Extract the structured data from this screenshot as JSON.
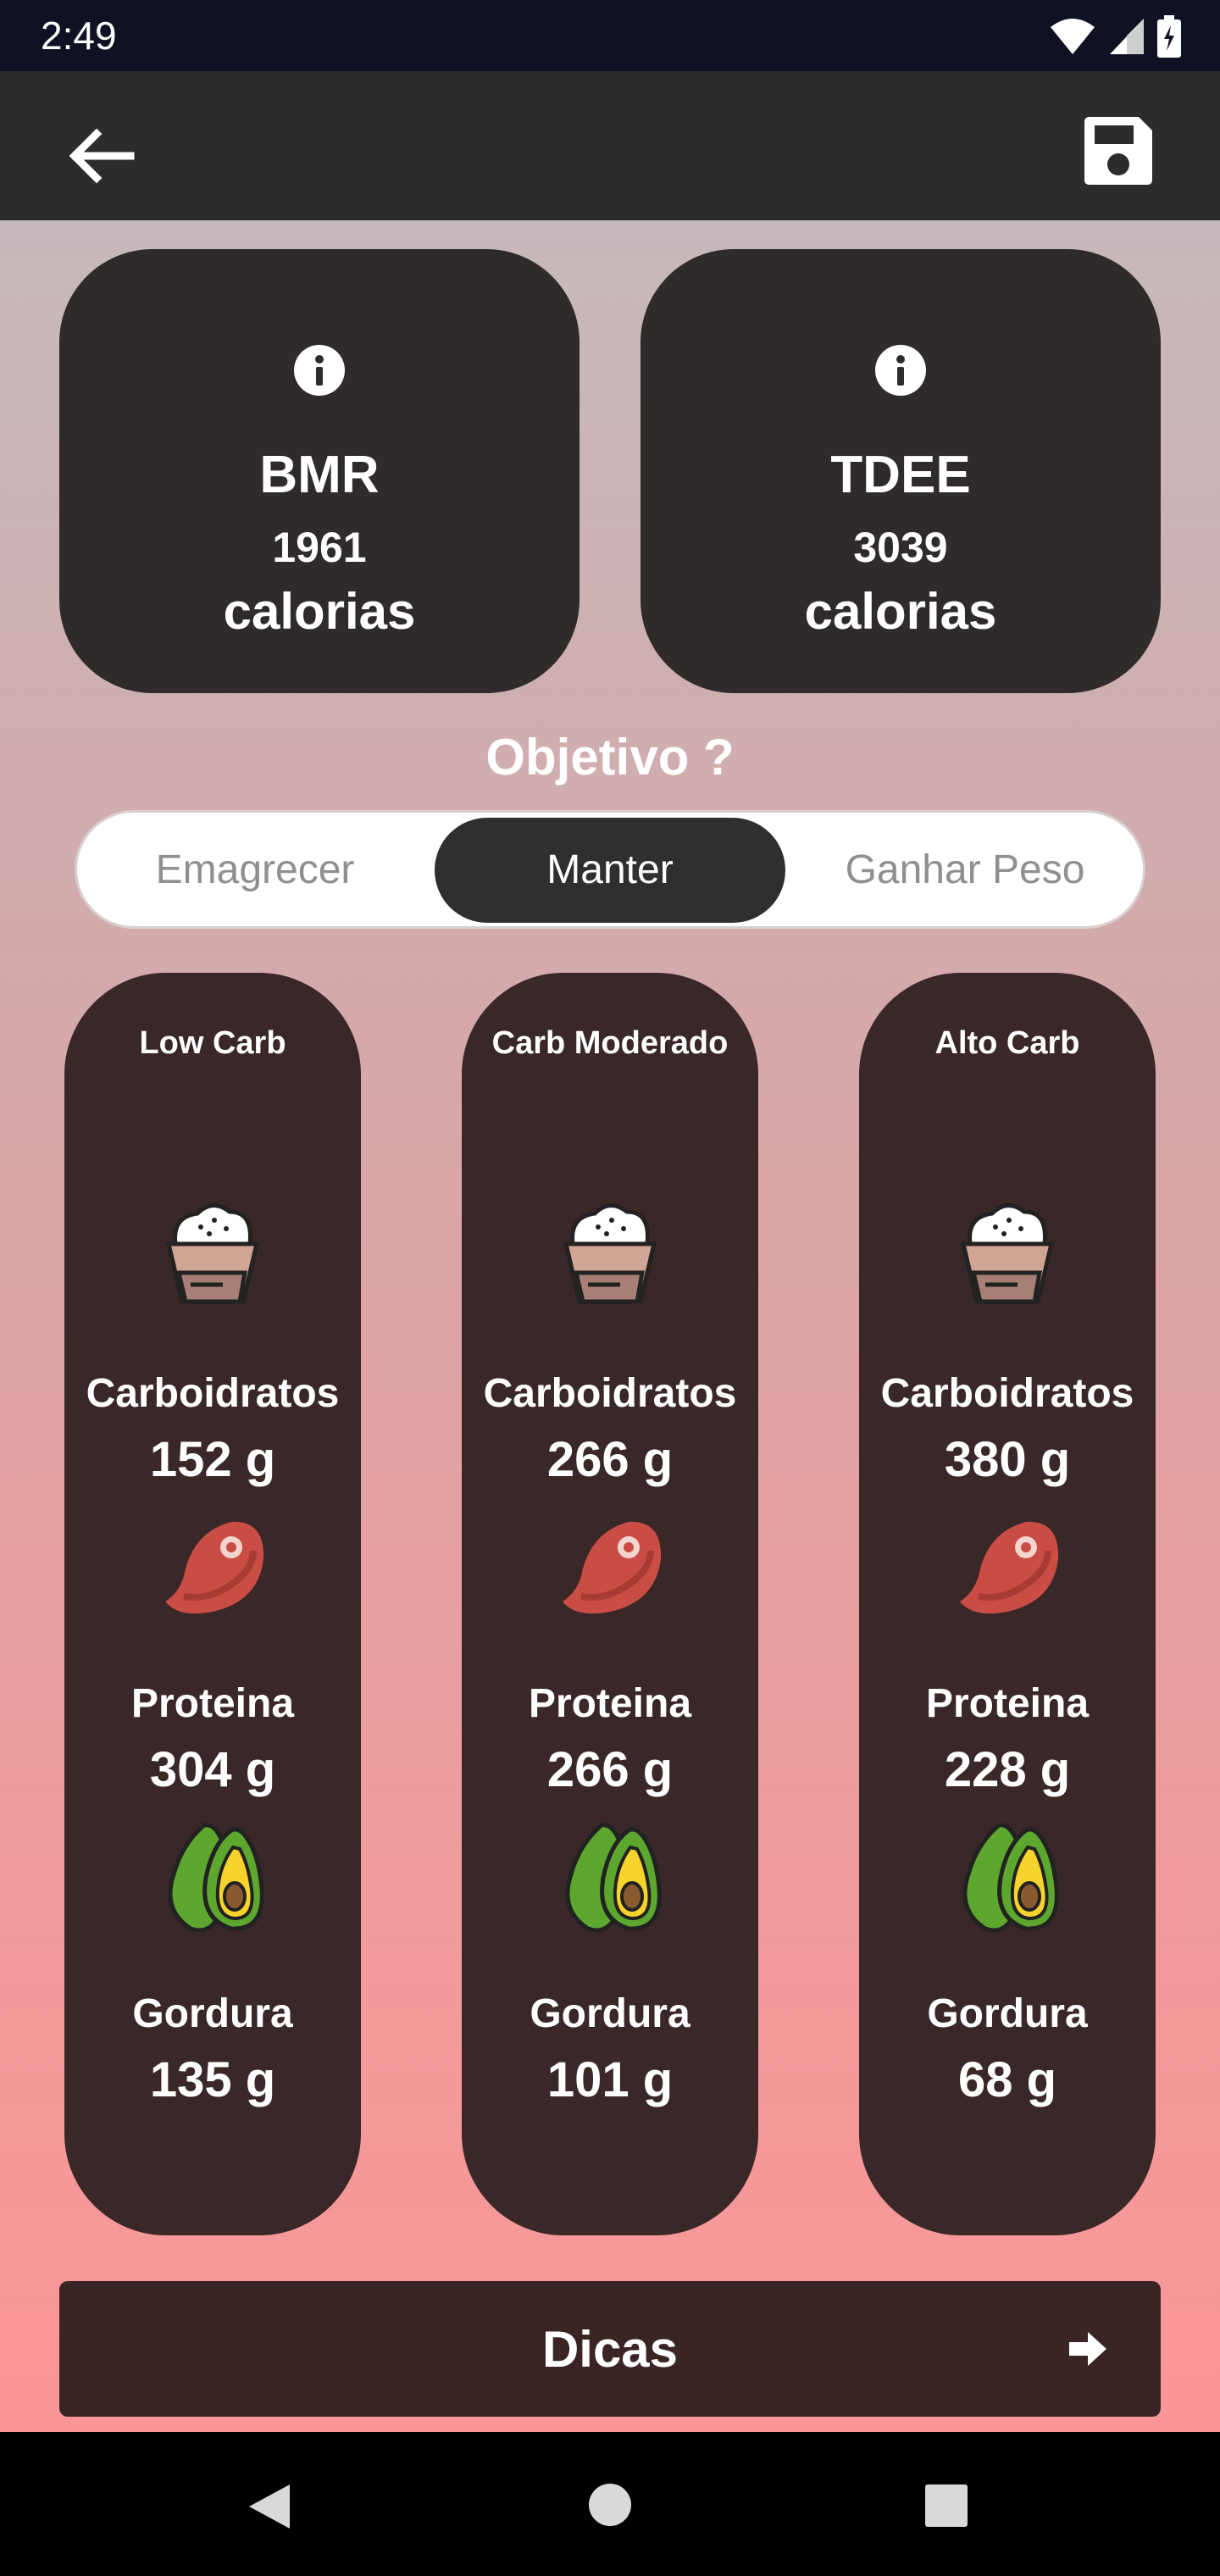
{
  "status": {
    "time": "2:49"
  },
  "summary": {
    "bmr": {
      "name": "BMR",
      "value": "1961",
      "unit": "calorias"
    },
    "tdee": {
      "name": "TDEE",
      "value": "3039",
      "unit": "calorias"
    }
  },
  "objective": {
    "title": "Objetivo ?",
    "options": [
      "Emagrecer",
      "Manter",
      "Ganhar Peso"
    ],
    "selected": "Manter"
  },
  "diets": [
    {
      "title": "Low Carb",
      "carb_label": "Carboidratos",
      "carb": "152 g",
      "protein_label": "Proteina",
      "protein": "304 g",
      "fat_label": "Gordura",
      "fat": "135 g"
    },
    {
      "title": "Carb Moderado",
      "carb_label": "Carboidratos",
      "carb": "266 g",
      "protein_label": "Proteina",
      "protein": "266 g",
      "fat_label": "Gordura",
      "fat": "101 g"
    },
    {
      "title": "Alto Carb",
      "carb_label": "Carboidratos",
      "carb": "380 g",
      "protein_label": "Proteina",
      "protein": "228 g",
      "fat_label": "Gordura",
      "fat": "68 g"
    }
  ],
  "tips": {
    "label": "Dicas"
  },
  "icons": {
    "back": "arrow-left-icon",
    "save": "floppy-disk-icon",
    "info": "info-icon",
    "carb": "rice-bowl-icon",
    "protein": "steak-icon",
    "fat": "avocado-icon",
    "arrow": "arrow-right-icon"
  },
  "colors": {
    "card": "#2f2b2b",
    "dietCard": "#3a2727",
    "appBar": "#2c2c2c",
    "accent": "#2f2f2f"
  }
}
